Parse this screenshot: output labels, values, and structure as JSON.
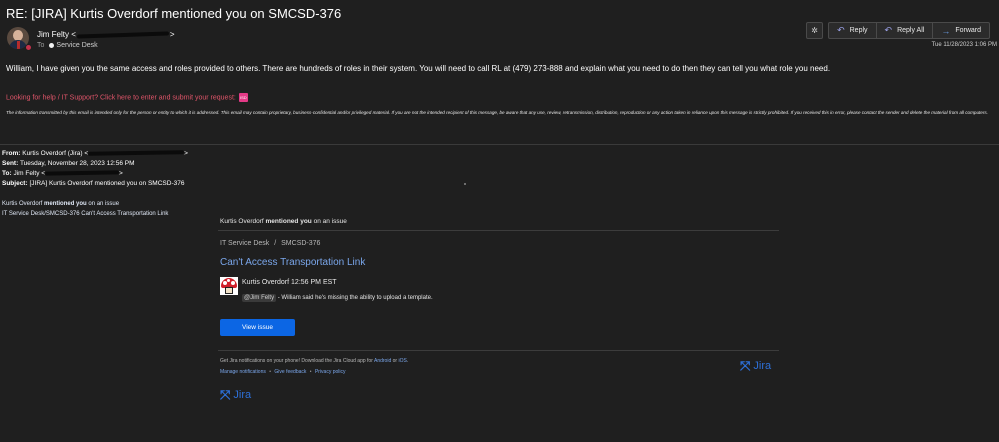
{
  "email": {
    "subject": "RE: [JIRA] Kurtis Overdorf mentioned you on SMCSD-376",
    "sender_name": "Jim Felty",
    "sender_open": "<",
    "sender_close": ">",
    "to_label": "To",
    "recipient": "Service Desk",
    "date": "Tue 11/28/2023 1:06 PM",
    "body": "William, I have given you the same access and roles provided to others.  There are hundreds of roles in their system.  You will need to call RL at (479) 273-888 and explain what you need to do then they can tell you what role you need.",
    "help_text": "Looking for help /  IT Support?  Click here to enter and submit your request:",
    "help_badge": "ISD",
    "disclaimer": "The information transmitted by this email is intended only for the person or entity to which it is addressed. This email may contain proprietary, business-confidential and/or privileged material. If you are not the intended recipient of this message, be aware that any use, review, retransmission, distribution, reproduction or any action taken in reliance upon this message is strictly prohibited. If you received this in error, please contact the sender and delete the material from all computers."
  },
  "toolbar": {
    "reply_label": "Reply",
    "reply_all_label": "Reply All",
    "forward_label": "Forward"
  },
  "quoted": {
    "from_label": "From:",
    "from_value": "Kurtis Overdorf (Jira) <",
    "from_close": ">",
    "sent_label": "Sent:",
    "sent_value": "Tuesday, November 28, 2023 12:56 PM",
    "to_label": "To:",
    "to_value": "Jim Felty <",
    "to_close": ">",
    "subject_label": "Subject:",
    "subject_value": "[JIRA] Kurtis Overdorf mentioned you on SMCSD-376",
    "mention_name": "Kurtis Overdorf",
    "mention_bold": "mentioned you",
    "mention_rest": "on an issue",
    "mention_path": "IT Service Desk/SMCSD-376 Can't Access Transportation Link"
  },
  "card": {
    "top_name": "Kurtis Overdorf",
    "top_bold": "mentioned you",
    "top_rest": "on an issue",
    "crumb_project": "IT Service Desk",
    "crumb_sep": "/",
    "crumb_issue": "SMCSD-376",
    "issue_title": "Can't Access Transportation Link",
    "author": "Kurtis Overdorf",
    "time": "12:56 PM EST",
    "mention_tag": "@Jim Felty",
    "comment": "- William said he's missing the ability to upload a template.",
    "button": "View issue",
    "footer_text": "Get Jira notifications on your phone! Download the Jira Cloud app for",
    "footer_android": "Android",
    "footer_or": "or",
    "footer_ios": "iOS",
    "footer_period": ".",
    "link_manage": "Manage notifications",
    "link_feedback": "Give feedback",
    "link_privacy": "Privacy policy",
    "link_sep": "•",
    "logo_word": "Jira"
  },
  "colors": {
    "background": "#1f1f1f",
    "link_blue": "#7aa6ea",
    "button_blue": "#0c66e4",
    "help_red": "#e0556a",
    "badge_pink": "#e43a87",
    "presence_red": "#c4314b"
  }
}
